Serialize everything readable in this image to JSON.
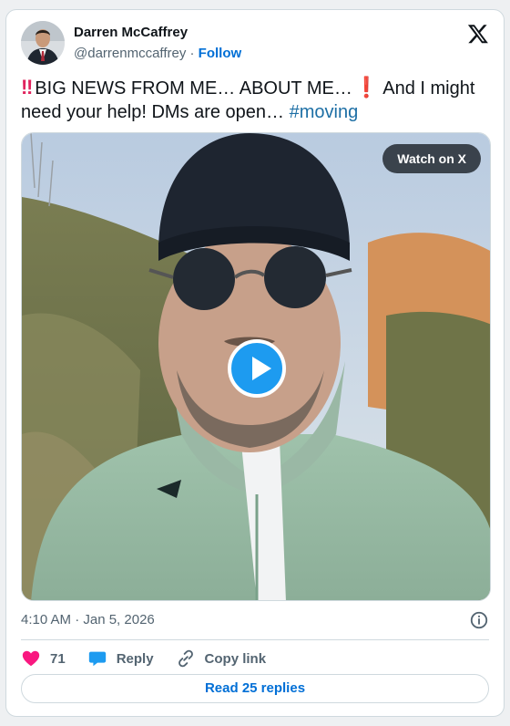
{
  "author": {
    "name": "Darren McCaffrey",
    "handle": "@darrenmccaffrey",
    "separator": " · ",
    "follow_label": "Follow"
  },
  "tweet": {
    "bang_double": "‼",
    "text_part1": "BIG NEWS FROM ME… ABOUT ME…",
    "bang_single": "❗",
    "text_part2": "And I might need your help! DMs are open…",
    "hashtag": "#moving"
  },
  "media": {
    "watch_label": "Watch on X"
  },
  "meta": {
    "timestamp": "4:10 AM · Jan 5, 2026"
  },
  "actions": {
    "like_count": "71",
    "reply_label": "Reply",
    "copy_label": "Copy link"
  },
  "footer": {
    "read_replies_label": "Read 25 replies"
  },
  "colors": {
    "link_blue": "#006fd6",
    "like_pink": "#f91880",
    "reply_blue": "#1d9bf0",
    "play_blue": "#1d9bf0"
  },
  "icons": [
    "x-logo-icon",
    "info-icon",
    "heart-icon",
    "reply-bubble-icon",
    "link-icon",
    "play-icon"
  ]
}
